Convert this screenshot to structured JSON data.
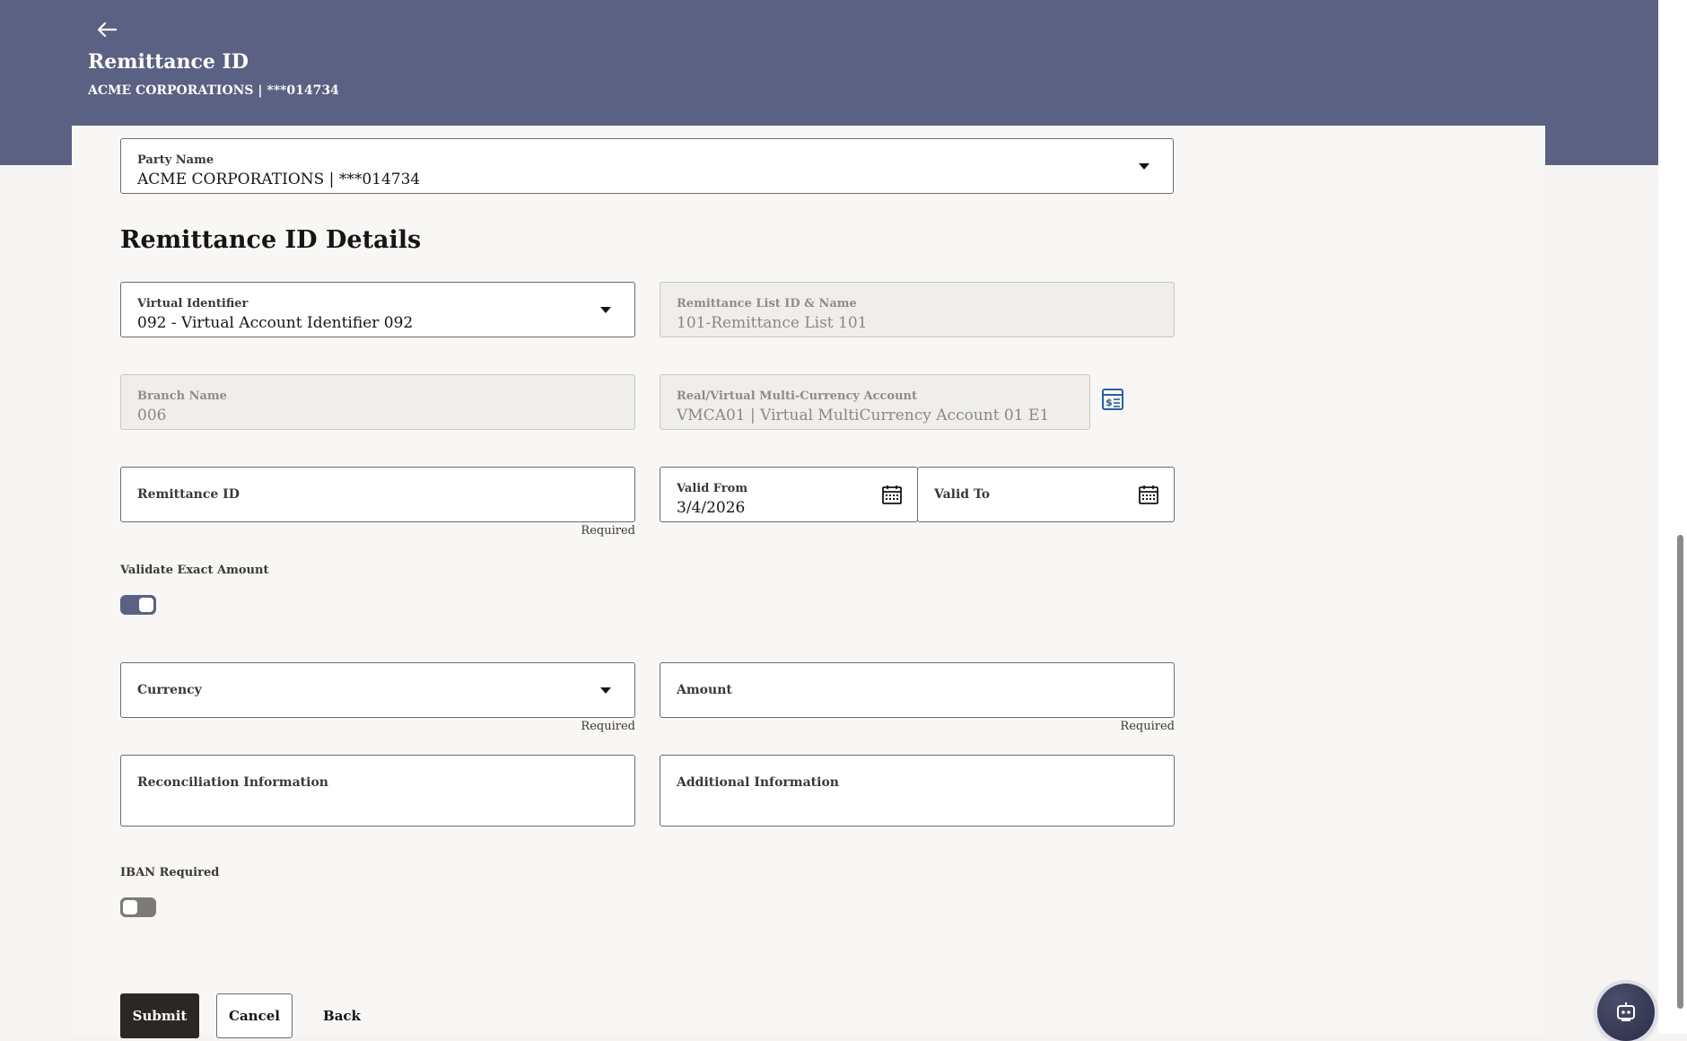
{
  "header": {
    "title": "Remittance ID",
    "subtitle": "ACME CORPORATIONS | ***014734"
  },
  "party": {
    "label": "Party Name",
    "value": "ACME CORPORATIONS | ***014734"
  },
  "section": {
    "title": "Remittance ID Details"
  },
  "fields": {
    "virtual_identifier": {
      "label": "Virtual Identifier",
      "value": "092 - Virtual Account Identifier 092"
    },
    "remittance_list": {
      "label": "Remittance List ID & Name",
      "value": "101-Remittance List 101"
    },
    "branch_name": {
      "label": "Branch Name",
      "value": "006"
    },
    "multi_currency_account": {
      "label": "Real/Virtual Multi-Currency Account",
      "value": "VMCA01 | Virtual MultiCurrency Account 01 E1"
    },
    "remittance_id": {
      "label": "Remittance ID",
      "helper": "Required"
    },
    "valid_from": {
      "label": "Valid From",
      "value": "3/4/2026"
    },
    "valid_to": {
      "label": "Valid To"
    },
    "currency": {
      "label": "Currency",
      "helper": "Required"
    },
    "amount": {
      "label": "Amount",
      "helper": "Required"
    },
    "reconciliation": {
      "label": "Reconciliation Information"
    },
    "additional": {
      "label": "Additional Information"
    }
  },
  "toggles": {
    "validate_exact_amount": {
      "label": "Validate Exact Amount",
      "state": "on"
    },
    "iban_required": {
      "label": "IBAN Required",
      "state": "off"
    }
  },
  "buttons": {
    "submit": "Submit",
    "cancel": "Cancel",
    "back": "Back"
  },
  "icons": {
    "back": "arrow-left-icon",
    "calendar": "calendar-icon",
    "account_lookup": "account-lookup-icon",
    "assistant": "assistant-bot-icon"
  },
  "colors": {
    "header_band": "#5b6182",
    "primary_button": "#2b2723",
    "toggle_on": "#5b6182",
    "toggle_off": "#7d7a77",
    "link_icon": "#2c5fa3"
  }
}
